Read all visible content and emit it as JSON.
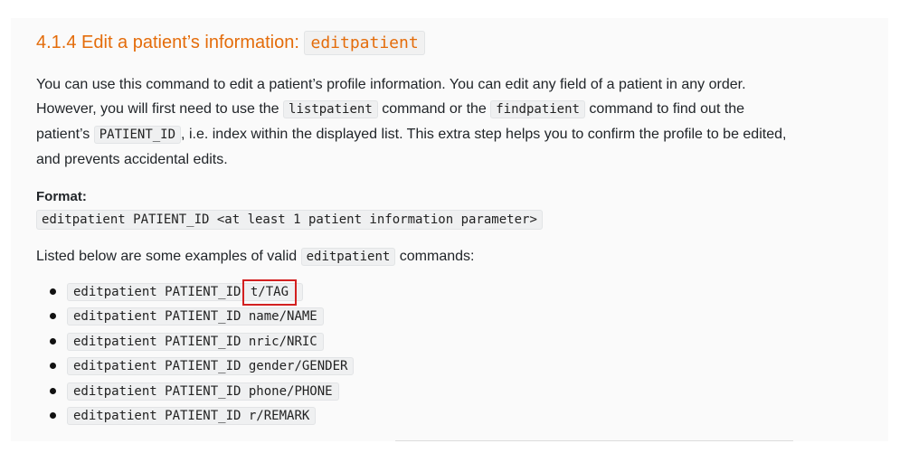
{
  "section": {
    "heading_text": "4.1.4 Edit a patient’s information:",
    "heading_code": "editpatient"
  },
  "intro": {
    "part1": "You can use this command to edit a patient’s profile information. You can edit any field of a patient in any order. However, you will first need to use the ",
    "code1": "listpatient",
    "part2": " command or the ",
    "code2": "findpatient",
    "part3": " command to find out the patient’s ",
    "code3": "PATIENT_ID",
    "part4": ", i.e. index within the displayed list. This extra step helps you to confirm the profile to be edited, and prevents accidental edits."
  },
  "format": {
    "label": "Format:",
    "code": "editpatient PATIENT_ID <at least 1 patient information parameter>"
  },
  "examples": {
    "intro_before": "Listed below are some examples of valid ",
    "intro_code": "editpatient",
    "intro_after": " commands:",
    "items": [
      {
        "prefix": "editpatient PATIENT_ID",
        "param": "t/TAG"
      },
      {
        "prefix": "editpatient PATIENT_ID",
        "param": "name/NAME"
      },
      {
        "prefix": "editpatient PATIENT_ID",
        "param": "nric/NRIC"
      },
      {
        "prefix": "editpatient PATIENT_ID",
        "param": "gender/GENDER"
      },
      {
        "prefix": "editpatient PATIENT_ID",
        "param": "phone/PHONE"
      },
      {
        "prefix": "editpatient PATIENT_ID",
        "param": "r/REMARK"
      }
    ]
  },
  "colors": {
    "heading": "#e46c0a",
    "highlight_border": "#d32020",
    "code_background": "#eff0f1"
  }
}
